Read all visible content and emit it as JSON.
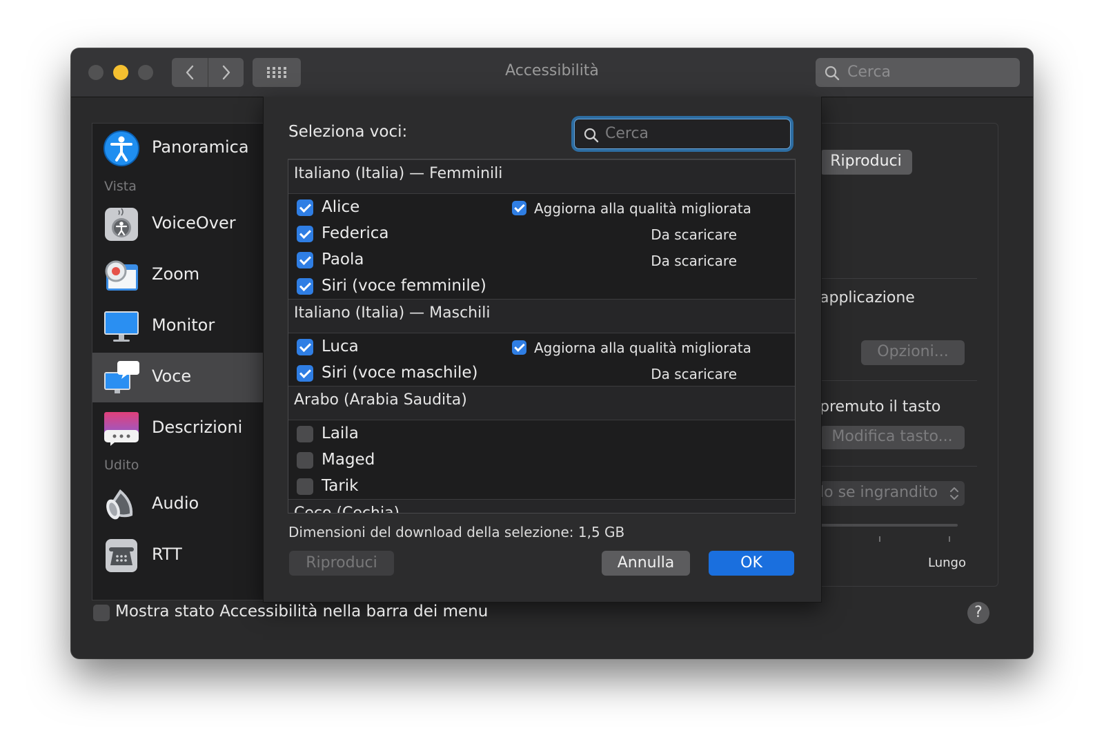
{
  "window": {
    "title": "Accessibilità",
    "search_placeholder": "Cerca"
  },
  "sidebar": {
    "items": [
      {
        "label": "Panoramica",
        "icon": "accessibility-icon"
      },
      {
        "label": "VoiceOver",
        "icon": "voiceover-icon"
      },
      {
        "label": "Zoom",
        "icon": "zoom-icon"
      },
      {
        "label": "Monitor",
        "icon": "monitor-icon"
      },
      {
        "label": "Voce",
        "icon": "speech-icon",
        "selected": true
      },
      {
        "label": "Descrizioni",
        "icon": "descriptions-icon"
      },
      {
        "label": "Audio",
        "icon": "speaker-icon"
      },
      {
        "label": "RTT",
        "icon": "telephone-icon"
      }
    ],
    "sections": [
      "Vista",
      "Udito"
    ]
  },
  "right_panel": {
    "play_button": "Riproduci",
    "text_application": "applicazione",
    "options_button": "Opzioni...",
    "text_key": "premuto il tasto",
    "modify_key_button": "Modifica tasto...",
    "popup_value": "lo se ingrandito",
    "slider_label_long": "Lungo"
  },
  "dialog": {
    "title": "Seleziona voci:",
    "search_placeholder": "Cerca",
    "groups": [
      {
        "title": "Italiano (Italia) — Femminili",
        "voices": [
          {
            "name": "Alice",
            "checked": true,
            "upgrade_label": "Aggiorna alla qualità migliorata",
            "upgrade_checked": true
          },
          {
            "name": "Federica",
            "checked": true,
            "status": "Da scaricare"
          },
          {
            "name": "Paola",
            "checked": true,
            "status": "Da scaricare"
          },
          {
            "name": "Siri (voce femminile)",
            "checked": true
          }
        ]
      },
      {
        "title": "Italiano (Italia) — Maschili",
        "voices": [
          {
            "name": "Luca",
            "checked": true,
            "upgrade_label": "Aggiorna alla qualità migliorata",
            "upgrade_checked": true
          },
          {
            "name": "Siri (voce maschile)",
            "checked": true,
            "status": "Da scaricare"
          }
        ]
      },
      {
        "title": "Arabo (Arabia Saudita)",
        "voices": [
          {
            "name": "Laila",
            "checked": false
          },
          {
            "name": "Maged",
            "checked": false
          },
          {
            "name": "Tarik",
            "checked": false
          }
        ]
      },
      {
        "title": "Ceco (Cechia)",
        "voices": []
      }
    ],
    "download_size": "Dimensioni del download della selezione: 1,5 GB",
    "play_button": "Riproduci",
    "cancel_button": "Annulla",
    "ok_button": "OK"
  },
  "footer": {
    "menu_status_label": "Mostra stato Accessibilità nella barra dei menu",
    "menu_status_checked": false,
    "help_label": "?"
  },
  "colors": {
    "accent": "#1a6fde",
    "checkbox_on": "#2f7ee4",
    "traffic_yellow": "#f5c030",
    "focus_ring": "#2d6da2"
  }
}
